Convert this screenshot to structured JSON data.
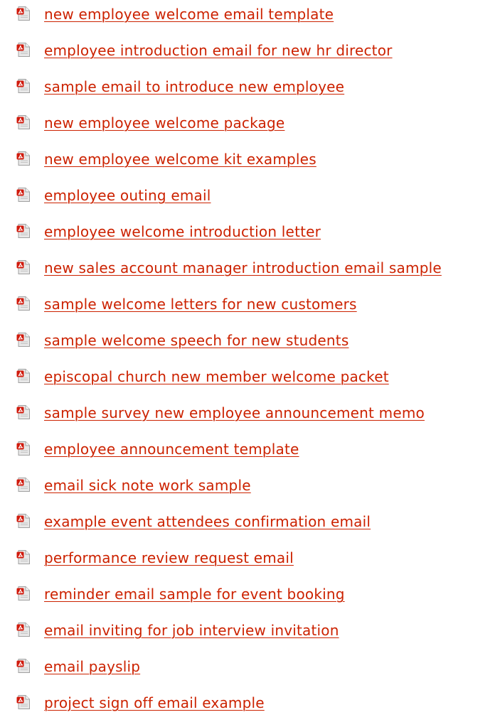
{
  "colors": {
    "link": "#cc2200",
    "icon_page": "#e8e8e8",
    "icon_border": "#a0a0a0",
    "icon_red": "#d11a0c"
  },
  "icon": "pdf-file-icon",
  "documents": [
    {
      "label": "new employee welcome email template"
    },
    {
      "label": "employee introduction email for new hr director"
    },
    {
      "label": "sample email to introduce new employee"
    },
    {
      "label": "new employee welcome package"
    },
    {
      "label": "new employee welcome kit examples"
    },
    {
      "label": "employee outing email"
    },
    {
      "label": "employee welcome introduction letter"
    },
    {
      "label": "new sales account manager introduction email sample"
    },
    {
      "label": "sample welcome letters for new customers"
    },
    {
      "label": "sample welcome speech for new students"
    },
    {
      "label": "episcopal church new member welcome packet"
    },
    {
      "label": "sample survey new employee announcement memo"
    },
    {
      "label": "employee announcement template"
    },
    {
      "label": "email sick note work sample"
    },
    {
      "label": "example event attendees confirmation email"
    },
    {
      "label": "performance review request email"
    },
    {
      "label": "reminder email sample for event booking"
    },
    {
      "label": "email inviting for job interview invitation"
    },
    {
      "label": "email payslip"
    },
    {
      "label": "project sign off email example"
    }
  ]
}
